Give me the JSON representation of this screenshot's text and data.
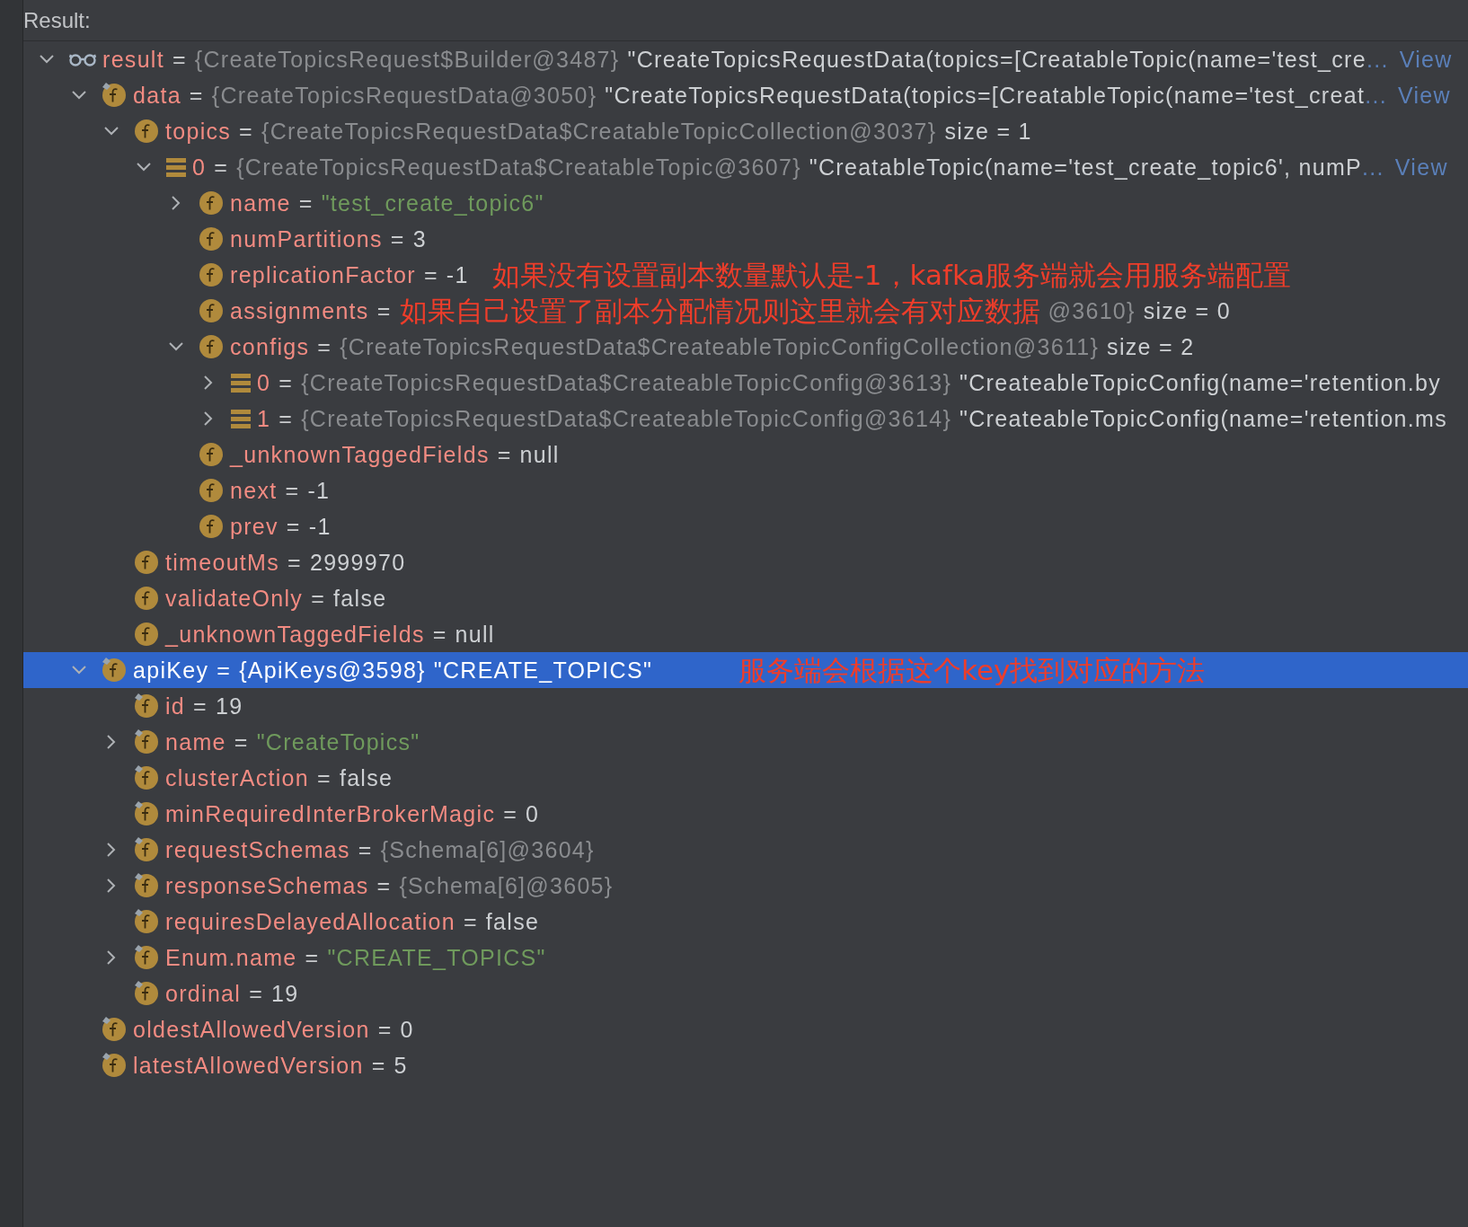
{
  "panel": {
    "title": "Result:"
  },
  "tree": [
    {
      "kind": "watch",
      "name": "result",
      "selected": false,
      "expanded": true,
      "value": [
        {
          "kind": "op",
          "text": "="
        },
        {
          "kind": "ref",
          "text": "{CreateTopicsRequest$Builder@3487}"
        },
        {
          "kind": "plain",
          "text": "\"CreateTopicsRequestData(topics=[CreatableTopic(name='test_cre"
        }
      ],
      "ellipsis": "...",
      "link": "View",
      "children": [
        {
          "kind": "static_field",
          "name": "data",
          "selected": false,
          "expanded": true,
          "value": [
            {
              "kind": "op",
              "text": "="
            },
            {
              "kind": "ref",
              "text": "{CreateTopicsRequestData@3050}"
            },
            {
              "kind": "plain",
              "text": "\"CreateTopicsRequestData(topics=[CreatableTopic(name='test_creat"
            }
          ],
          "ellipsis": "...",
          "link": "View",
          "children": [
            {
              "kind": "field",
              "name": "topics",
              "selected": false,
              "expanded": true,
              "value": [
                {
                  "kind": "op",
                  "text": "="
                },
                {
                  "kind": "ref",
                  "text": "{CreateTopicsRequestData$CreatableTopicCollection@3037}"
                },
                {
                  "kind": "size",
                  "text": "size = 1"
                }
              ],
              "children": [
                {
                  "kind": "element",
                  "name": "0",
                  "selected": false,
                  "expanded": true,
                  "value": [
                    {
                      "kind": "op",
                      "text": "="
                    },
                    {
                      "kind": "ref",
                      "text": "{CreateTopicsRequestData$CreatableTopic@3607}"
                    },
                    {
                      "kind": "plain",
                      "text": "\"CreatableTopic(name='test_create_topic6', numP"
                    }
                  ],
                  "ellipsis": "...",
                  "link": "View",
                  "children": [
                    {
                      "kind": "field",
                      "name": "name",
                      "selected": false,
                      "expanded": false,
                      "value": [
                        {
                          "kind": "op",
                          "text": "="
                        },
                        {
                          "kind": "str",
                          "text": "\"test_create_topic6\""
                        }
                      ]
                    },
                    {
                      "kind": "field",
                      "name": "numPartitions",
                      "selected": false,
                      "value": [
                        {
                          "kind": "op",
                          "text": "="
                        },
                        {
                          "kind": "plain",
                          "text": "3"
                        }
                      ]
                    },
                    {
                      "kind": "field",
                      "name": "replicationFactor",
                      "selected": false,
                      "value": [
                        {
                          "kind": "op",
                          "text": "="
                        },
                        {
                          "kind": "plain",
                          "text": "-1"
                        },
                        {
                          "kind": "note",
                          "text": "如果没有设置副本数量默认是-1，kafka服务端就会用服务端配置"
                        }
                      ]
                    },
                    {
                      "kind": "field",
                      "name": "assignments",
                      "selected": false,
                      "value": [
                        {
                          "kind": "op",
                          "text": "="
                        },
                        {
                          "kind": "note",
                          "text": "如果自己设置了副本分配情况则这里就会有对应数据"
                        },
                        {
                          "kind": "ref",
                          "text": "@3610}"
                        },
                        {
                          "kind": "size",
                          "text": "size = 0"
                        }
                      ]
                    },
                    {
                      "kind": "field",
                      "name": "configs",
                      "selected": false,
                      "expanded": true,
                      "value": [
                        {
                          "kind": "op",
                          "text": "="
                        },
                        {
                          "kind": "ref",
                          "text": "{CreateTopicsRequestData$CreateableTopicConfigCollection@3611}"
                        },
                        {
                          "kind": "size",
                          "text": "size = 2"
                        }
                      ],
                      "children": [
                        {
                          "kind": "element",
                          "name": "0",
                          "selected": false,
                          "expanded": false,
                          "value": [
                            {
                              "kind": "op",
                              "text": "="
                            },
                            {
                              "kind": "ref",
                              "text": "{CreateTopicsRequestData$CreateableTopicConfig@3613}"
                            },
                            {
                              "kind": "plain",
                              "text": "\"CreateableTopicConfig(name='retention.by"
                            }
                          ]
                        },
                        {
                          "kind": "element",
                          "name": "1",
                          "selected": false,
                          "expanded": false,
                          "value": [
                            {
                              "kind": "op",
                              "text": "="
                            },
                            {
                              "kind": "ref",
                              "text": "{CreateTopicsRequestData$CreateableTopicConfig@3614}"
                            },
                            {
                              "kind": "plain",
                              "text": "\"CreateableTopicConfig(name='retention.ms"
                            }
                          ]
                        }
                      ]
                    },
                    {
                      "kind": "field",
                      "name": "_unknownTaggedFields",
                      "selected": false,
                      "value": [
                        {
                          "kind": "op",
                          "text": "="
                        },
                        {
                          "kind": "plain",
                          "text": "null"
                        }
                      ]
                    },
                    {
                      "kind": "field",
                      "name": "next",
                      "selected": false,
                      "value": [
                        {
                          "kind": "op",
                          "text": "="
                        },
                        {
                          "kind": "plain",
                          "text": "-1"
                        }
                      ]
                    },
                    {
                      "kind": "field",
                      "name": "prev",
                      "selected": false,
                      "value": [
                        {
                          "kind": "op",
                          "text": "="
                        },
                        {
                          "kind": "plain",
                          "text": "-1"
                        }
                      ]
                    }
                  ]
                }
              ]
            },
            {
              "kind": "field",
              "name": "timeoutMs",
              "selected": false,
              "value": [
                {
                  "kind": "op",
                  "text": "="
                },
                {
                  "kind": "plain",
                  "text": "2999970"
                }
              ]
            },
            {
              "kind": "field",
              "name": "validateOnly",
              "selected": false,
              "value": [
                {
                  "kind": "op",
                  "text": "="
                },
                {
                  "kind": "plain",
                  "text": "false"
                }
              ]
            },
            {
              "kind": "field",
              "name": "_unknownTaggedFields",
              "selected": false,
              "value": [
                {
                  "kind": "op",
                  "text": "="
                },
                {
                  "kind": "plain",
                  "text": "null"
                }
              ]
            }
          ]
        },
        {
          "kind": "static_field",
          "name": "apiKey",
          "selected": true,
          "expanded": true,
          "value": [
            {
              "kind": "op",
              "text": "="
            },
            {
              "kind": "ref",
              "text": "{ApiKeys@3598}"
            },
            {
              "kind": "plain",
              "text": "\"CREATE_TOPICS\""
            },
            {
              "kind": "note",
              "text": "服务端会根据这个key找到对应的方法"
            }
          ],
          "children": [
            {
              "kind": "static_field",
              "name": "id",
              "selected": false,
              "value": [
                {
                  "kind": "op",
                  "text": "="
                },
                {
                  "kind": "plain",
                  "text": "19"
                }
              ]
            },
            {
              "kind": "static_field",
              "name": "name",
              "selected": false,
              "expanded": false,
              "value": [
                {
                  "kind": "op",
                  "text": "="
                },
                {
                  "kind": "str",
                  "text": "\"CreateTopics\""
                }
              ]
            },
            {
              "kind": "static_field",
              "name": "clusterAction",
              "selected": false,
              "value": [
                {
                  "kind": "op",
                  "text": "="
                },
                {
                  "kind": "plain",
                  "text": "false"
                }
              ]
            },
            {
              "kind": "static_field",
              "name": "minRequiredInterBrokerMagic",
              "selected": false,
              "value": [
                {
                  "kind": "op",
                  "text": "="
                },
                {
                  "kind": "plain",
                  "text": "0"
                }
              ]
            },
            {
              "kind": "static_field",
              "name": "requestSchemas",
              "selected": false,
              "expanded": false,
              "value": [
                {
                  "kind": "op",
                  "text": "="
                },
                {
                  "kind": "ref",
                  "text": "{Schema[6]@3604}"
                }
              ]
            },
            {
              "kind": "static_field",
              "name": "responseSchemas",
              "selected": false,
              "expanded": false,
              "value": [
                {
                  "kind": "op",
                  "text": "="
                },
                {
                  "kind": "ref",
                  "text": "{Schema[6]@3605}"
                }
              ]
            },
            {
              "kind": "static_field",
              "name": "requiresDelayedAllocation",
              "selected": false,
              "value": [
                {
                  "kind": "op",
                  "text": "="
                },
                {
                  "kind": "plain",
                  "text": "false"
                }
              ]
            },
            {
              "kind": "static_field",
              "name": "Enum.name",
              "selected": false,
              "expanded": false,
              "value": [
                {
                  "kind": "op",
                  "text": "="
                },
                {
                  "kind": "str",
                  "text": "\"CREATE_TOPICS\""
                }
              ]
            },
            {
              "kind": "static_field",
              "name": "ordinal",
              "selected": false,
              "value": [
                {
                  "kind": "op",
                  "text": "="
                },
                {
                  "kind": "plain",
                  "text": "19"
                }
              ]
            }
          ]
        },
        {
          "kind": "static_field",
          "name": "oldestAllowedVersion",
          "selected": false,
          "value": [
            {
              "kind": "op",
              "text": "="
            },
            {
              "kind": "plain",
              "text": "0"
            }
          ]
        },
        {
          "kind": "static_field",
          "name": "latestAllowedVersion",
          "selected": false,
          "value": [
            {
              "kind": "op",
              "text": "="
            },
            {
              "kind": "plain",
              "text": "5"
            }
          ]
        }
      ]
    }
  ]
}
